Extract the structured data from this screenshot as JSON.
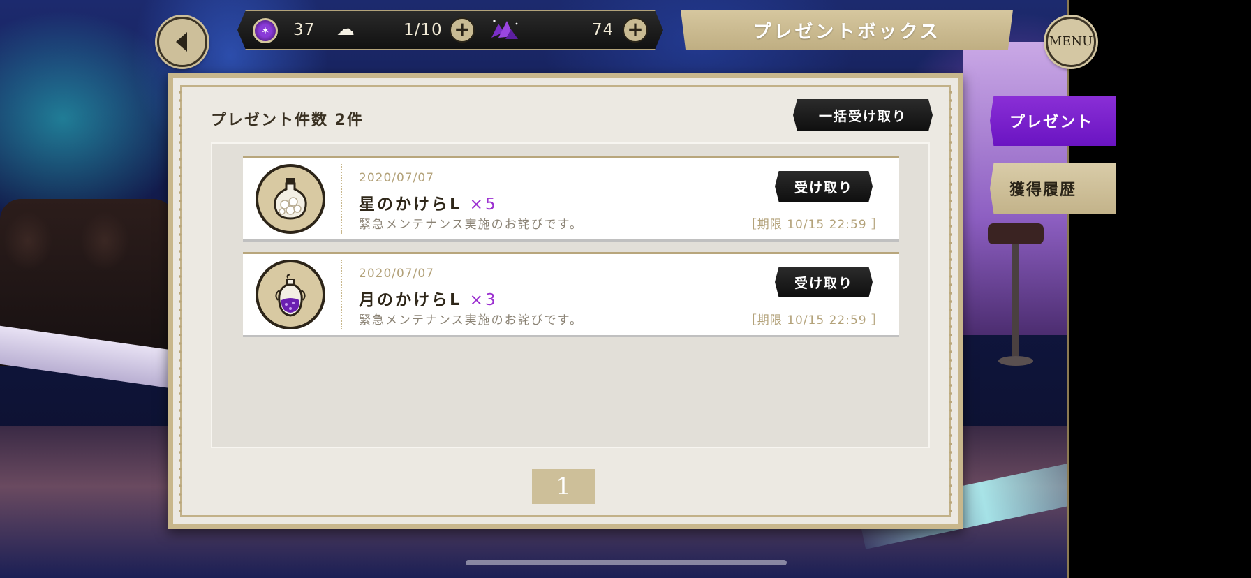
{
  "header": {
    "title": "プレゼントボックス",
    "menu_label": "MENU"
  },
  "resources": {
    "orb_count": "37",
    "stamina": "1/10",
    "gems": "74"
  },
  "side_tabs": [
    {
      "label": "プレゼント",
      "active": true
    },
    {
      "label": "獲得履歴",
      "active": false
    }
  ],
  "panel": {
    "count_label": "プレゼント件数 2件",
    "bulk_receive_label": "一括受け取り",
    "items": [
      {
        "date": "2020/07/07",
        "name": "星のかけらL",
        "qty": "×5",
        "message": "緊急メンテナンス実施のお詫びです。",
        "receive_label": "受け取り",
        "expiry": "［期限 10/15 22:59 ］",
        "icon": "star-fragment-bottle-icon"
      },
      {
        "date": "2020/07/07",
        "name": "月のかけらL",
        "qty": "×3",
        "message": "緊急メンテナンス実施のお詫びです。",
        "receive_label": "受け取り",
        "expiry": "［期限 10/15 22:59 ］",
        "icon": "moon-fragment-bottle-icon"
      }
    ],
    "page": "1"
  },
  "colors": {
    "accent_purple": "#7a1fcc",
    "gold": "#c8b78c",
    "qty_purple": "#9b2fd0"
  }
}
